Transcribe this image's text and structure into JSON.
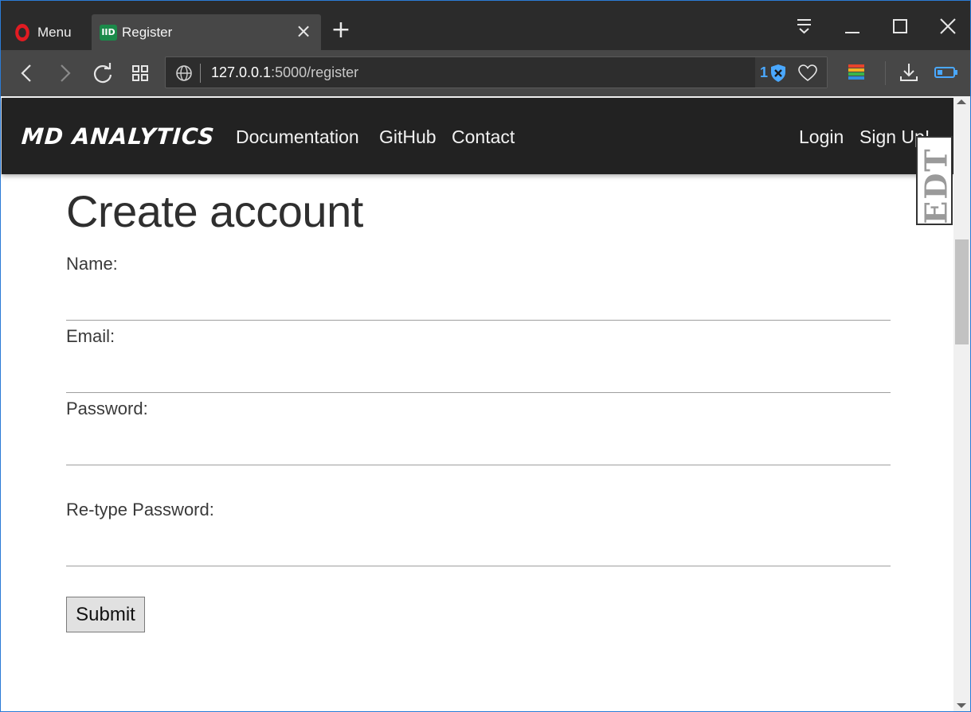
{
  "browser": {
    "menu_label": "Menu",
    "tab_title": "Register",
    "tab_favicon_text": "IID",
    "new_tab_symbol": "+",
    "tab_close_symbol": "×",
    "url_host": "127.0.0.1",
    "url_path": ":5000/register",
    "blocker_count": "1",
    "accent_color": "#4aa8ff",
    "icons": [
      "opera-icon",
      "easy-setup-icon",
      "minimize-icon",
      "maximize-icon",
      "close-icon",
      "back-icon",
      "forward-icon",
      "reload-icon",
      "speed-dial-icon",
      "globe-icon",
      "shield-icon",
      "heart-icon",
      "wallet-icon",
      "download-icon",
      "battery-icon"
    ]
  },
  "navbar": {
    "brand": "MD ANALYTICS",
    "links": [
      "Documentation",
      "GitHub",
      "Contact"
    ],
    "login": "Login",
    "signup": "Sign Up!",
    "background": "#222222"
  },
  "badge": {
    "text": "EDT"
  },
  "form": {
    "title": "Create account",
    "fields": [
      {
        "label": "Name:",
        "value": ""
      },
      {
        "label": "Email:",
        "value": ""
      },
      {
        "label": "Password:",
        "value": ""
      },
      {
        "label": "Re-type Password:",
        "value": ""
      }
    ],
    "submit_label": "Submit"
  }
}
